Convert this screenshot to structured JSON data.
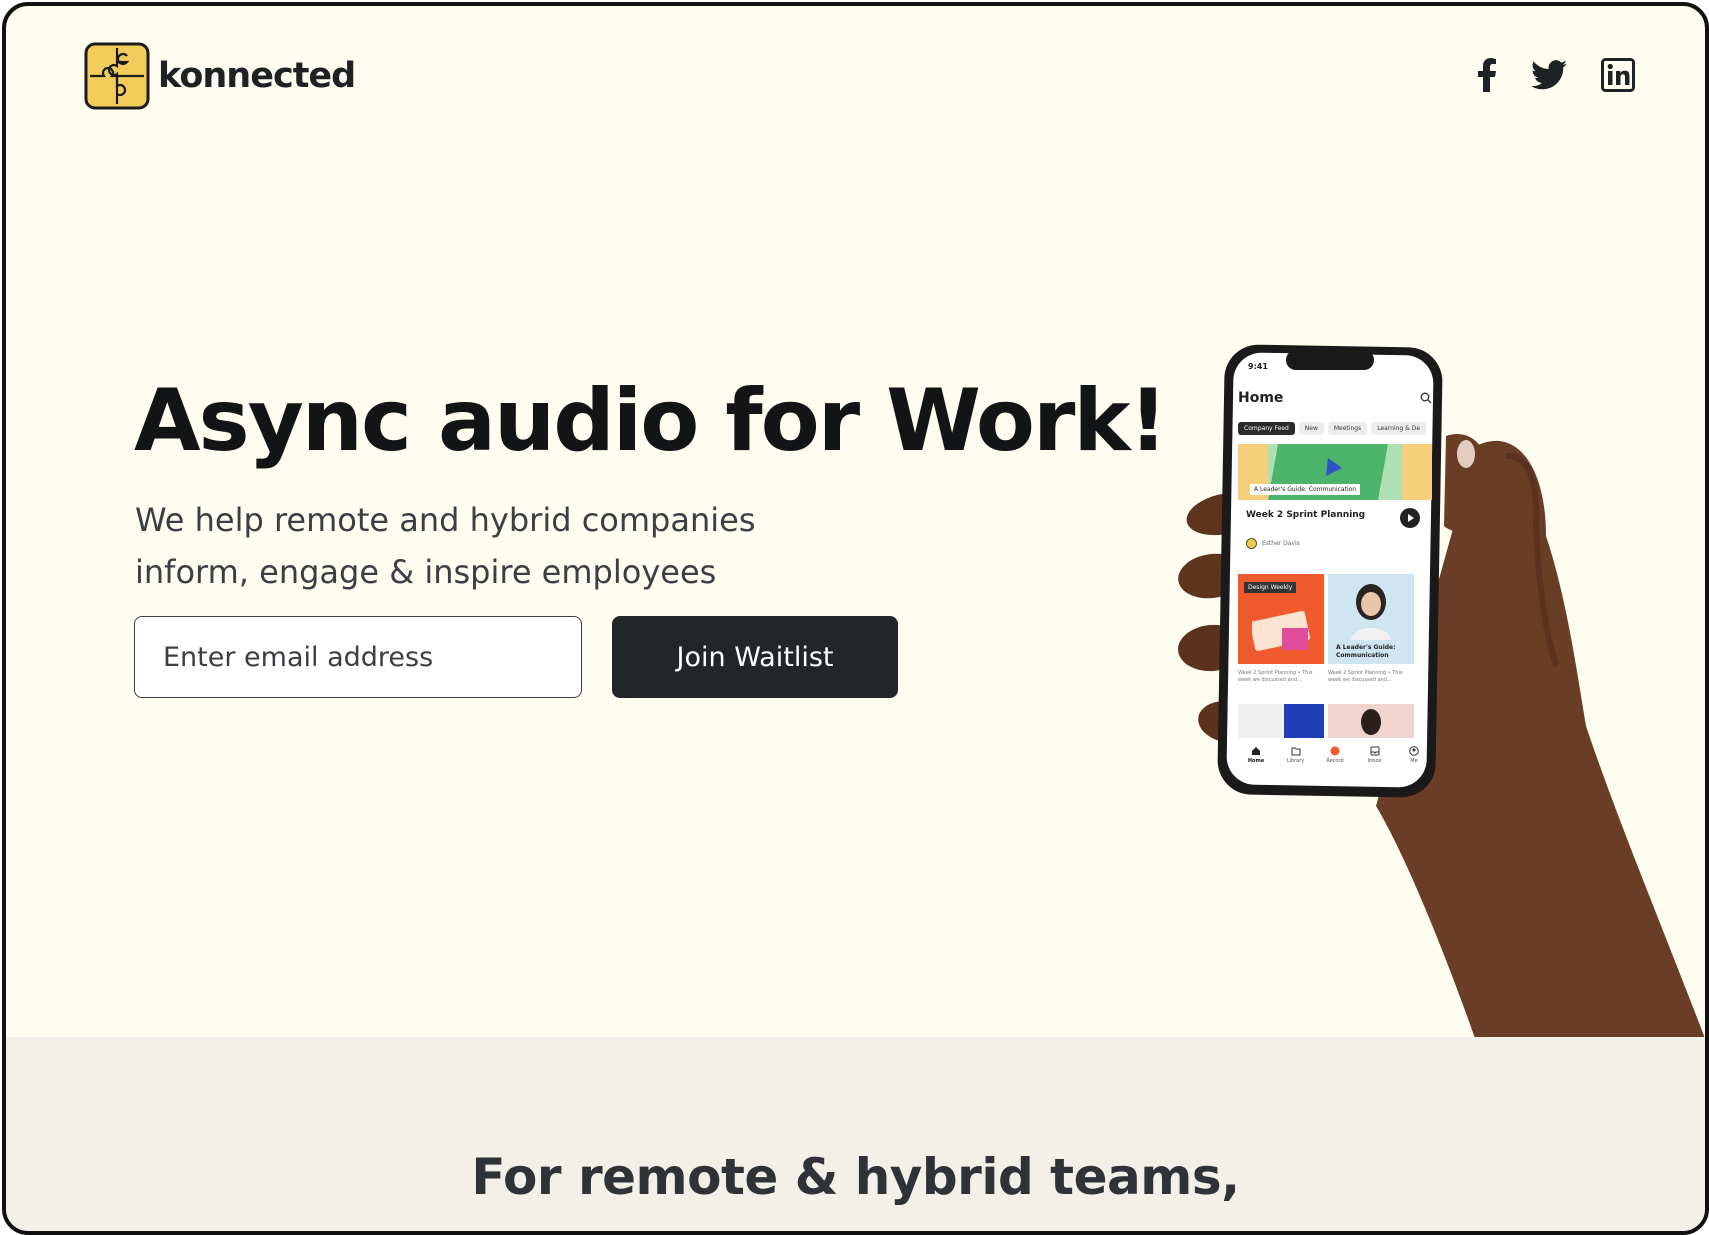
{
  "brand": {
    "name": "konnected",
    "logo_icon": "puzzle-logo-icon",
    "logo_color": "#f2cd5c"
  },
  "social": [
    {
      "icon": "facebook-icon"
    },
    {
      "icon": "twitter-icon"
    },
    {
      "icon": "linkedin-icon"
    }
  ],
  "hero": {
    "title": "Async audio for Work!",
    "subtitle_line1": "We help remote and hybrid companies",
    "subtitle_line2": "inform, engage & inspire employees",
    "email_placeholder": "Enter email address",
    "cta_label": "Join Waitlist"
  },
  "phone": {
    "time": "9:41",
    "screen_title": "Home",
    "chips": [
      "Company Feed",
      "New",
      "Meetings",
      "Learning & De"
    ],
    "active_chip": "Company Feed",
    "banner_label": "A Leader's Guide: Communication",
    "card_title": "Week 2 Sprint Planning",
    "card_author": "Esther Davis",
    "tile_a_label": "Design Weekly",
    "tile_b_label": "A Leader's Guide: Communication",
    "tile_desc": "Week 2 Sprint Planning • This week we discussed and...",
    "nav": [
      "Home",
      "Library",
      "Record",
      "Inbox",
      "Me"
    ],
    "record_color": "#ef5a2f"
  },
  "section2": {
    "heading": "For remote & hybrid  teams,"
  },
  "colors": {
    "page_bg": "#fefdef",
    "band_bg": "#f2f0e9",
    "button_bg": "#222629"
  }
}
